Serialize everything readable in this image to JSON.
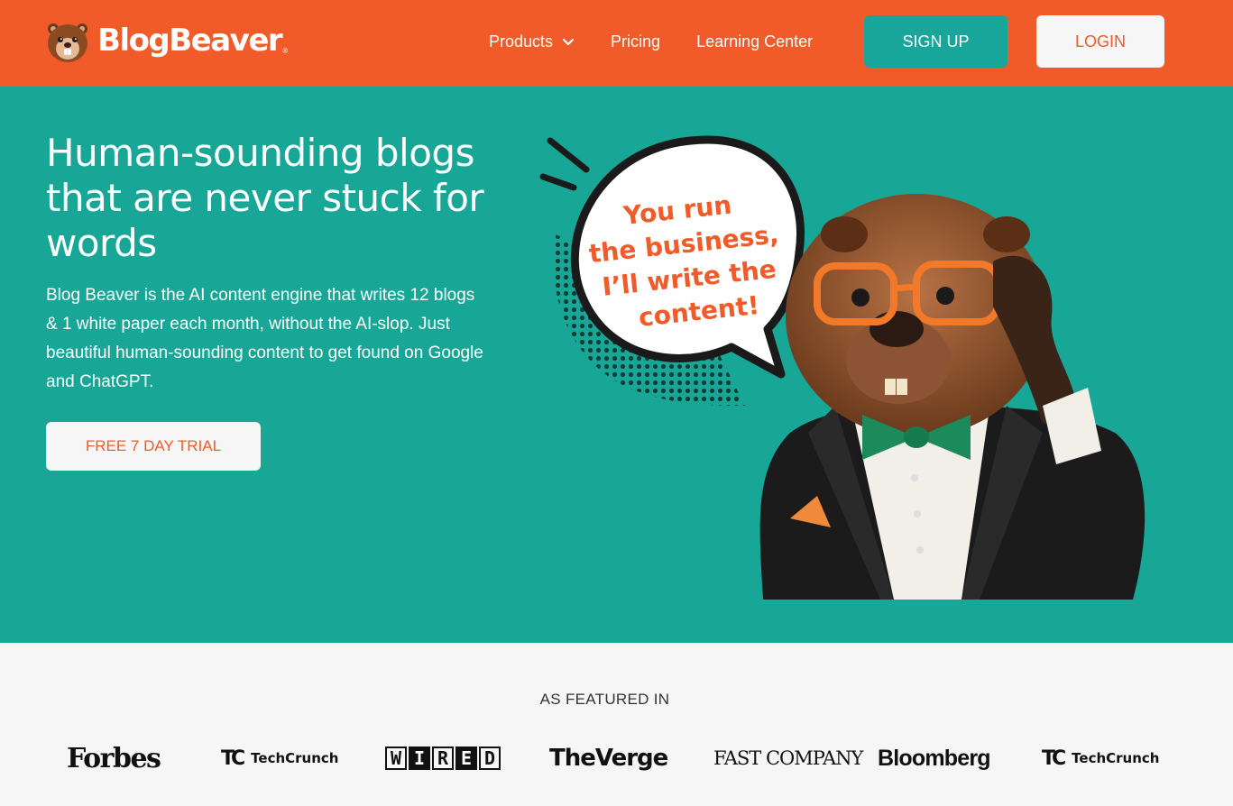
{
  "header": {
    "brand": "BlogBeaver",
    "brand_mark": "®",
    "nav": [
      {
        "label": "Products"
      },
      {
        "label": "Pricing"
      },
      {
        "label": "Learning Center"
      }
    ],
    "signup_label": "SIGN UP",
    "login_label": "LOGIN"
  },
  "hero": {
    "title": "Human-sounding blogs that are never stuck for words",
    "subtitle": "Blog Beaver is the AI content engine that writes 12 blogs & 1 white paper each month, without the AI-slop. Just beautiful human-sounding content to get found on Google and ChatGPT.",
    "cta_label": "FREE 7 DAY TRIAL",
    "bubble_lines": [
      "You run",
      "the business,",
      "I’ll write the",
      "content!"
    ]
  },
  "featured": {
    "label": "AS FEATURED IN",
    "logos": [
      "Forbes",
      "TechCrunch",
      "WIRED",
      "The Verge",
      "FAST COMPANY",
      "Bloomberg",
      "TechCrunch"
    ],
    "wired_letters": [
      "W",
      "I",
      "R",
      "E",
      "D"
    ],
    "verge_text": "TheVerge",
    "fastco_text": "FAST COMPANY"
  },
  "colors": {
    "brand_orange": "#f15a29",
    "brand_teal": "#18a697",
    "light": "#f6f6f6"
  },
  "icons": [
    "beaver-logo-icon",
    "chevron-down-icon"
  ]
}
